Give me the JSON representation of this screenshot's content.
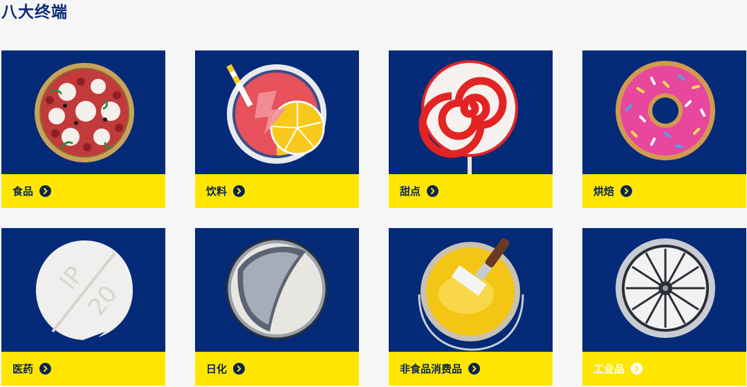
{
  "page_title": "八大终端",
  "cards": [
    {
      "label": "食品",
      "icon": "pizza-icon"
    },
    {
      "label": "饮料",
      "icon": "drink-icon"
    },
    {
      "label": "甜点",
      "icon": "lollipop-icon"
    },
    {
      "label": "烘焙",
      "icon": "donut-icon"
    },
    {
      "label": "医药",
      "icon": "pill-icon"
    },
    {
      "label": "日化",
      "icon": "seal-lid-icon"
    },
    {
      "label": "非食品消费品",
      "icon": "paint-bucket-icon"
    },
    {
      "label": "工业品",
      "icon": "turbine-icon"
    }
  ],
  "colors": {
    "card_background": "#042a78",
    "label_bar": "#ffe600",
    "title": "#0b2a78",
    "arrow_circle": "#0b2456"
  }
}
